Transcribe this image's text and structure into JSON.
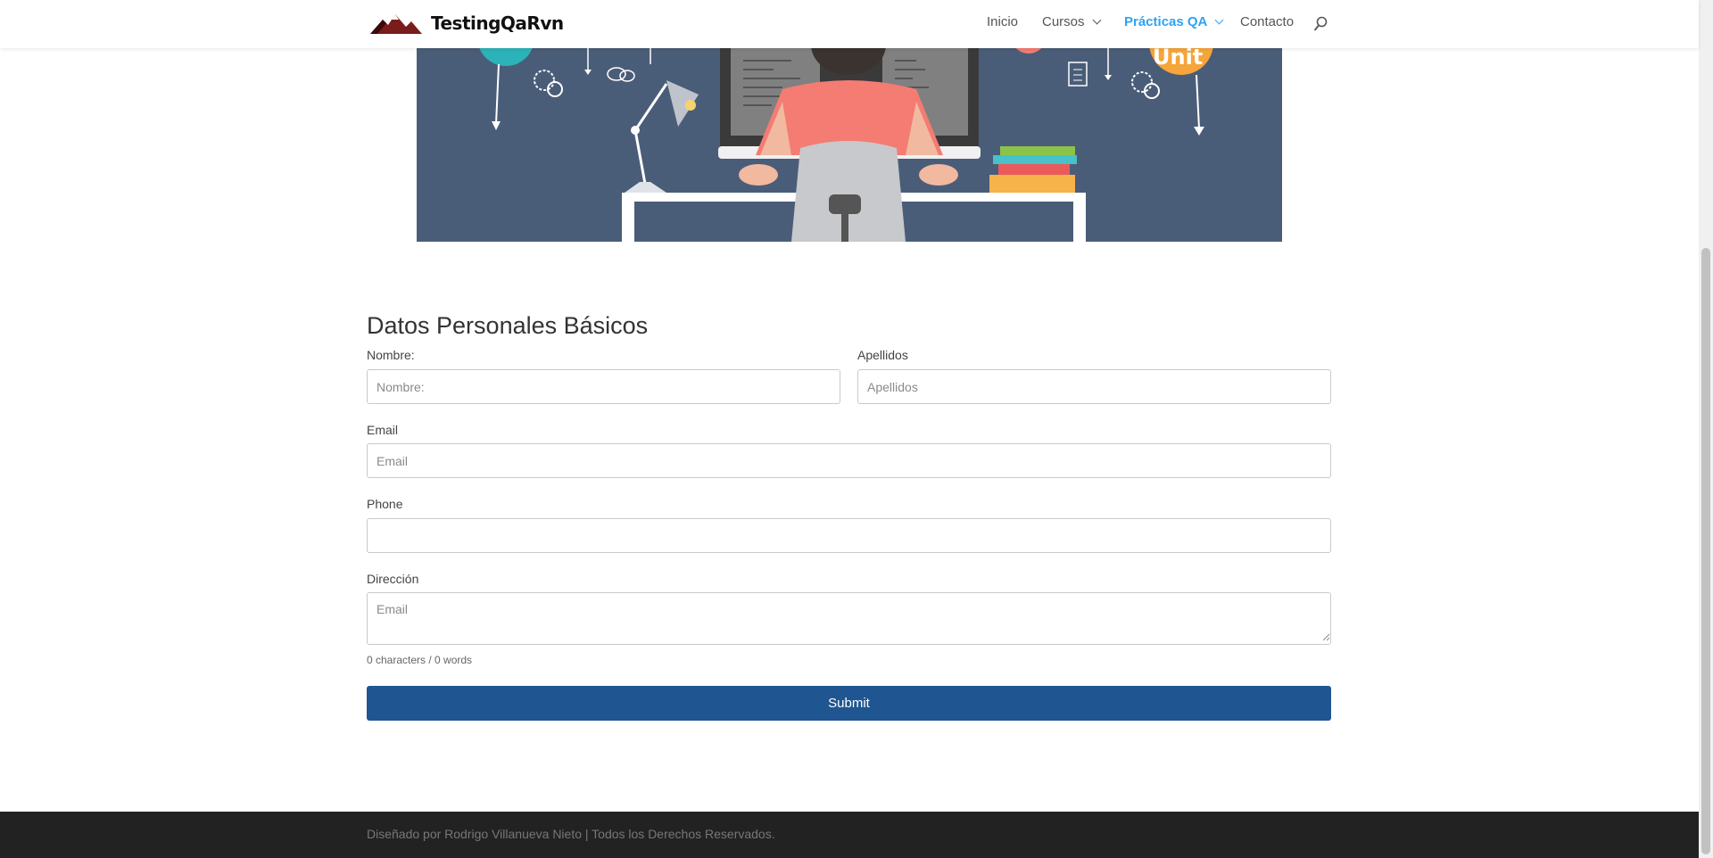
{
  "header": {
    "brand": "TestingQaRvn",
    "nav": [
      {
        "label": "Inicio"
      },
      {
        "label": "Cursos"
      },
      {
        "label": "Prácticas QA"
      },
      {
        "label": "Contacto"
      }
    ],
    "active_color": "#2ea3f2"
  },
  "hero": {
    "badge_text": "Unit"
  },
  "form": {
    "title": "Datos Personales Básicos",
    "nombre": {
      "label": "Nombre:",
      "placeholder": "Nombre:",
      "value": ""
    },
    "apellidos": {
      "label": "Apellidos",
      "placeholder": "Apellidos",
      "value": ""
    },
    "email": {
      "label": "Email",
      "placeholder": "Email",
      "value": ""
    },
    "phone": {
      "label": "Phone",
      "placeholder": "",
      "value": ""
    },
    "direccion": {
      "label": "Dirección",
      "placeholder": "Email",
      "value": ""
    },
    "counter": "0 characters / 0 words",
    "submit_label": "Submit",
    "submit_color": "#1f5591"
  },
  "footer": {
    "text": "Diseñado por Rodrigo Villanueva Nieto | Todos los Derechos Reservados."
  }
}
